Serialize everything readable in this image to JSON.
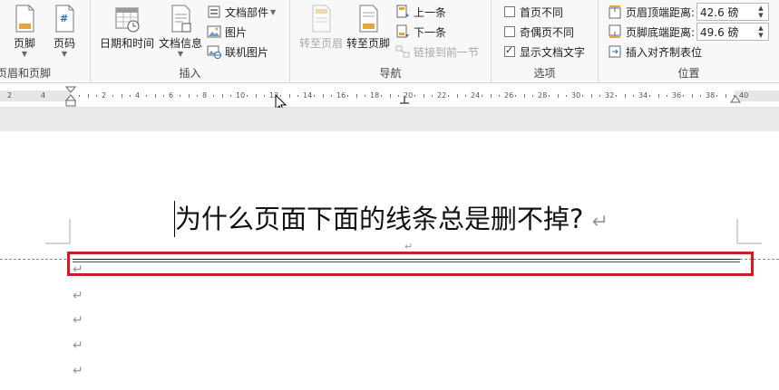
{
  "ribbon": {
    "groups": {
      "header_footer": "页眉和页脚",
      "insert": "插入",
      "navigation": "导航",
      "options": "选项",
      "position": "位置"
    },
    "header_footer": {
      "footer": "页脚",
      "page_number": "页码"
    },
    "insert": {
      "date_time": "日期和时间",
      "doc_info": "文档信息",
      "doc_parts": "文档部件",
      "picture": "图片",
      "online_picture": "联机图片"
    },
    "navigation": {
      "goto_header": "转至页眉",
      "goto_footer": "转至页脚",
      "previous": "上一条",
      "next": "下一条",
      "link_previous": "链接到前一节"
    },
    "options": {
      "first_page_diff": "首页不同",
      "odd_even_diff": "奇偶页不同",
      "show_doc_text": "显示文档文字",
      "show_doc_text_checked": true
    },
    "position": {
      "header_top_label": "页眉顶端距离:",
      "header_top_value": "42.6 磅",
      "footer_bottom_label": "页脚底端距离:",
      "footer_bottom_value": "49.6 磅",
      "insert_align_tab": "插入对齐制表位"
    }
  },
  "ruler": {
    "left_ticks": [
      "4",
      "2"
    ],
    "ticks": [
      "2",
      "4",
      "6",
      "8",
      "10",
      "12",
      "14",
      "16",
      "18",
      "20",
      "22",
      "24",
      "26",
      "28",
      "30",
      "32",
      "34",
      "36",
      "38",
      "40"
    ]
  },
  "document": {
    "heading": "为什么页面下面的线条总是删不掉?",
    "return_mark": "↵"
  },
  "colors": {
    "highlight_box": "#cc1f1f",
    "ribbon_bg": "#f8f8f8"
  }
}
